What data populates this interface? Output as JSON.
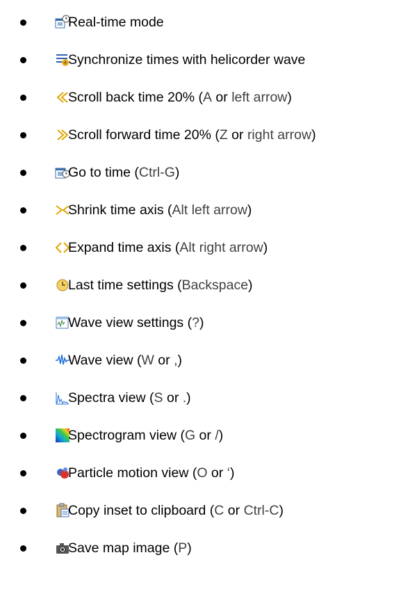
{
  "items": [
    {
      "icon": "real-time-mode-icon",
      "parts": [
        "Real-time mode",
        "",
        "",
        "",
        ""
      ]
    },
    {
      "icon": "synchronize-times-icon",
      "parts": [
        "Synchronize times with helicorder wave",
        "",
        "",
        "",
        ""
      ]
    },
    {
      "icon": "scroll-back-icon",
      "parts": [
        "Scroll back time 20% (",
        "A",
        " or ",
        "left arrow",
        ")"
      ]
    },
    {
      "icon": "scroll-forward-icon",
      "parts": [
        "Scroll forward time 20% (",
        "Z",
        " or ",
        "right arrow",
        ")"
      ]
    },
    {
      "icon": "go-to-time-icon",
      "parts": [
        "Go to time (",
        "Ctrl-G",
        ")",
        "",
        ""
      ]
    },
    {
      "icon": "shrink-time-axis-icon",
      "parts": [
        "Shrink time axis (",
        "Alt left arrow",
        ")",
        "",
        ""
      ]
    },
    {
      "icon": "expand-time-axis-icon",
      "parts": [
        "Expand time axis (",
        "Alt right arrow",
        ")",
        "",
        ""
      ]
    },
    {
      "icon": "last-time-settings-icon",
      "parts": [
        "Last time settings (",
        "Backspace",
        ")",
        "",
        ""
      ]
    },
    {
      "icon": "wave-view-settings-icon",
      "parts": [
        "Wave view settings (",
        "?",
        ")",
        "",
        ""
      ]
    },
    {
      "icon": "wave-view-icon",
      "parts": [
        "Wave view (",
        "W",
        " or ",
        ",",
        ")"
      ]
    },
    {
      "icon": "spectra-view-icon",
      "parts": [
        "Spectra view (",
        "S",
        " or ",
        ".",
        ")"
      ]
    },
    {
      "icon": "spectrogram-view-icon",
      "parts": [
        "Spectrogram view (",
        "G",
        " or ",
        "/",
        ")"
      ]
    },
    {
      "icon": "particle-motion-view-icon",
      "parts": [
        "Particle motion view (",
        "O",
        " or ",
        "‘",
        ")"
      ]
    },
    {
      "icon": "copy-inset-icon",
      "parts": [
        "Copy inset to clipboard (",
        "C",
        " or ",
        "Ctrl-C",
        ")"
      ]
    },
    {
      "icon": "save-map-image-icon",
      "parts": [
        "Save map image (",
        "P",
        ")",
        "",
        ""
      ]
    }
  ]
}
